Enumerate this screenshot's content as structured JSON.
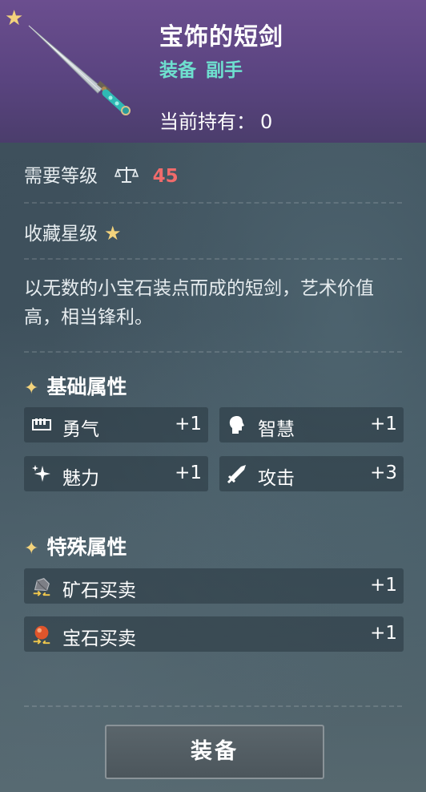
{
  "item": {
    "name": "宝饰的短剑",
    "type_primary": "装备",
    "type_secondary": "副手",
    "owned_label": "当前持有：",
    "owned_value": "0",
    "rarity_stars": 1
  },
  "requirement": {
    "label": "需要等级",
    "icon": "scale-icon",
    "value": "45"
  },
  "collection": {
    "label": "收藏星级",
    "stars": 1
  },
  "description": "以无数的小宝石装点而成的短剑，艺术价值高，相当锋利。",
  "base_attributes": {
    "title": "基础属性",
    "stats": [
      {
        "icon": "courage-icon",
        "label": "勇气",
        "value": "+1"
      },
      {
        "icon": "wisdom-icon",
        "label": "智慧",
        "value": "+1"
      },
      {
        "icon": "charm-icon",
        "label": "魅力",
        "value": "+1"
      },
      {
        "icon": "attack-icon",
        "label": "攻击",
        "value": "+3"
      }
    ]
  },
  "special_attributes": {
    "title": "特殊属性",
    "stats": [
      {
        "icon": "ore-trade-icon",
        "label": "矿石买卖",
        "value": "+1"
      },
      {
        "icon": "gem-trade-icon",
        "label": "宝石买卖",
        "value": "+1"
      }
    ]
  },
  "actions": {
    "equip_label": "装备"
  },
  "colors": {
    "header_purple": "#5a4480",
    "type_teal": "#6ee0cf",
    "level_red": "#f16b6b",
    "star_gold": "#f3d37c"
  }
}
